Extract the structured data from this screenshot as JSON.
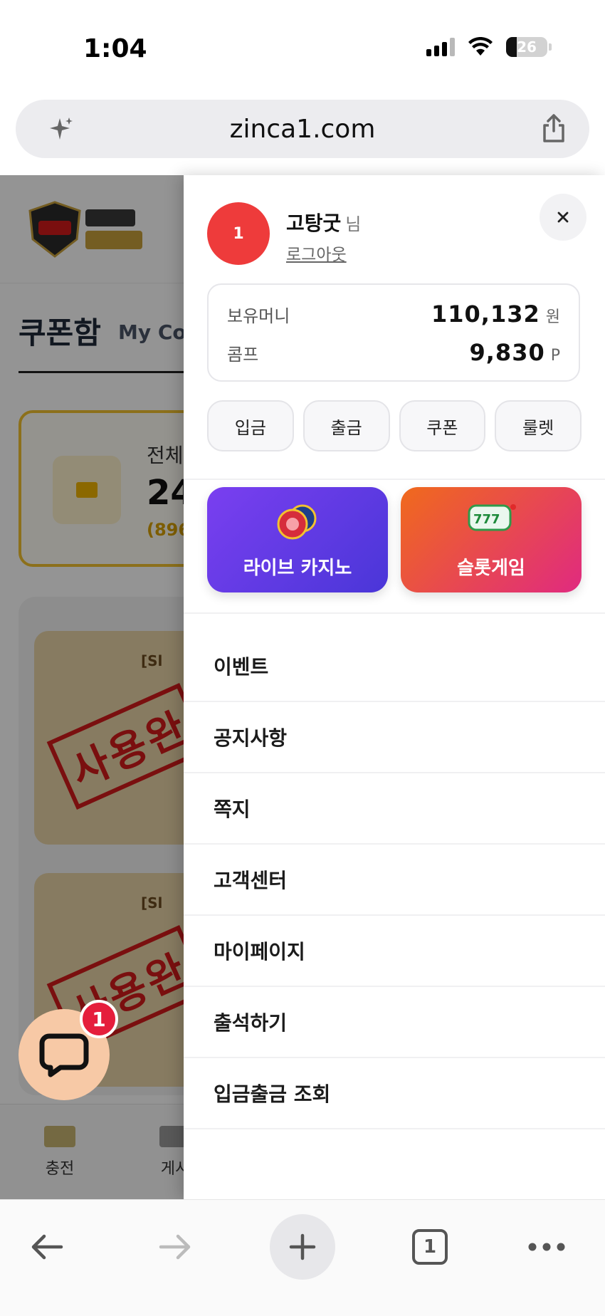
{
  "status_bar": {
    "time": "1:04",
    "battery": "26",
    "battery_level": 0.26
  },
  "browser": {
    "url": "zinca1.com",
    "tab_count": "1"
  },
  "background_page": {
    "title": "쿠폰함",
    "subtitle": "My Co",
    "summary_label": "전체",
    "summary_value": "24",
    "summary_sub": "(896",
    "coupon_tag": "[Sl",
    "coupon_stamp": "사용완",
    "nav": [
      "충전",
      "게시"
    ]
  },
  "chat": {
    "badge_count": "1"
  },
  "drawer": {
    "user": {
      "level": "1",
      "name": "고탕굿",
      "suffix": "님",
      "logout": "로그아웃"
    },
    "balance": {
      "money_label": "보유머니",
      "money_value": "110,132",
      "money_unit": "원",
      "comp_label": "콤프",
      "comp_value": "9,830",
      "comp_unit": "P"
    },
    "actions": [
      "입금",
      "출금",
      "쿠폰",
      "룰렛"
    ],
    "games": [
      {
        "label": "라이브 카지노",
        "color": "#5b3be6"
      },
      {
        "label": "슬롯게임",
        "color": "#e8463e"
      }
    ],
    "menu": [
      "이벤트",
      "공지사항",
      "쪽지",
      "고객센터",
      "마이페이지",
      "출석하기",
      "입금출금 조회"
    ]
  },
  "colors": {
    "avatar": "#ee3b3b",
    "badge": "#e51e3c",
    "stamp": "#d21a1a"
  }
}
